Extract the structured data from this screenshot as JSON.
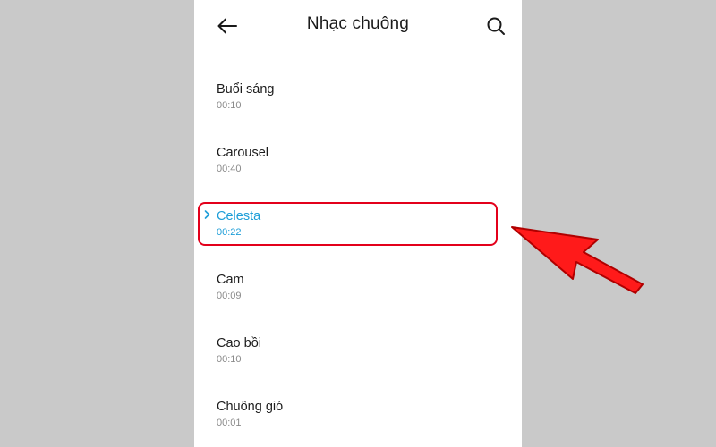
{
  "header": {
    "title": "Nhạc chuông",
    "back_icon": "arrow-left-icon",
    "search_icon": "search-icon"
  },
  "ringtones": [
    {
      "name": "Buổi sáng",
      "duration": "00:10",
      "selected": false
    },
    {
      "name": "Carousel",
      "duration": "00:40",
      "selected": false
    },
    {
      "name": "Celesta",
      "duration": "00:22",
      "selected": true
    },
    {
      "name": "Cam",
      "duration": "00:09",
      "selected": false
    },
    {
      "name": "Cao bồi",
      "duration": "00:10",
      "selected": false
    },
    {
      "name": "Chuông gió",
      "duration": "00:01",
      "selected": false
    }
  ],
  "colors": {
    "accent": "#1e9ed8",
    "annotation": "#e3001b",
    "background": "#c9c9c9"
  }
}
